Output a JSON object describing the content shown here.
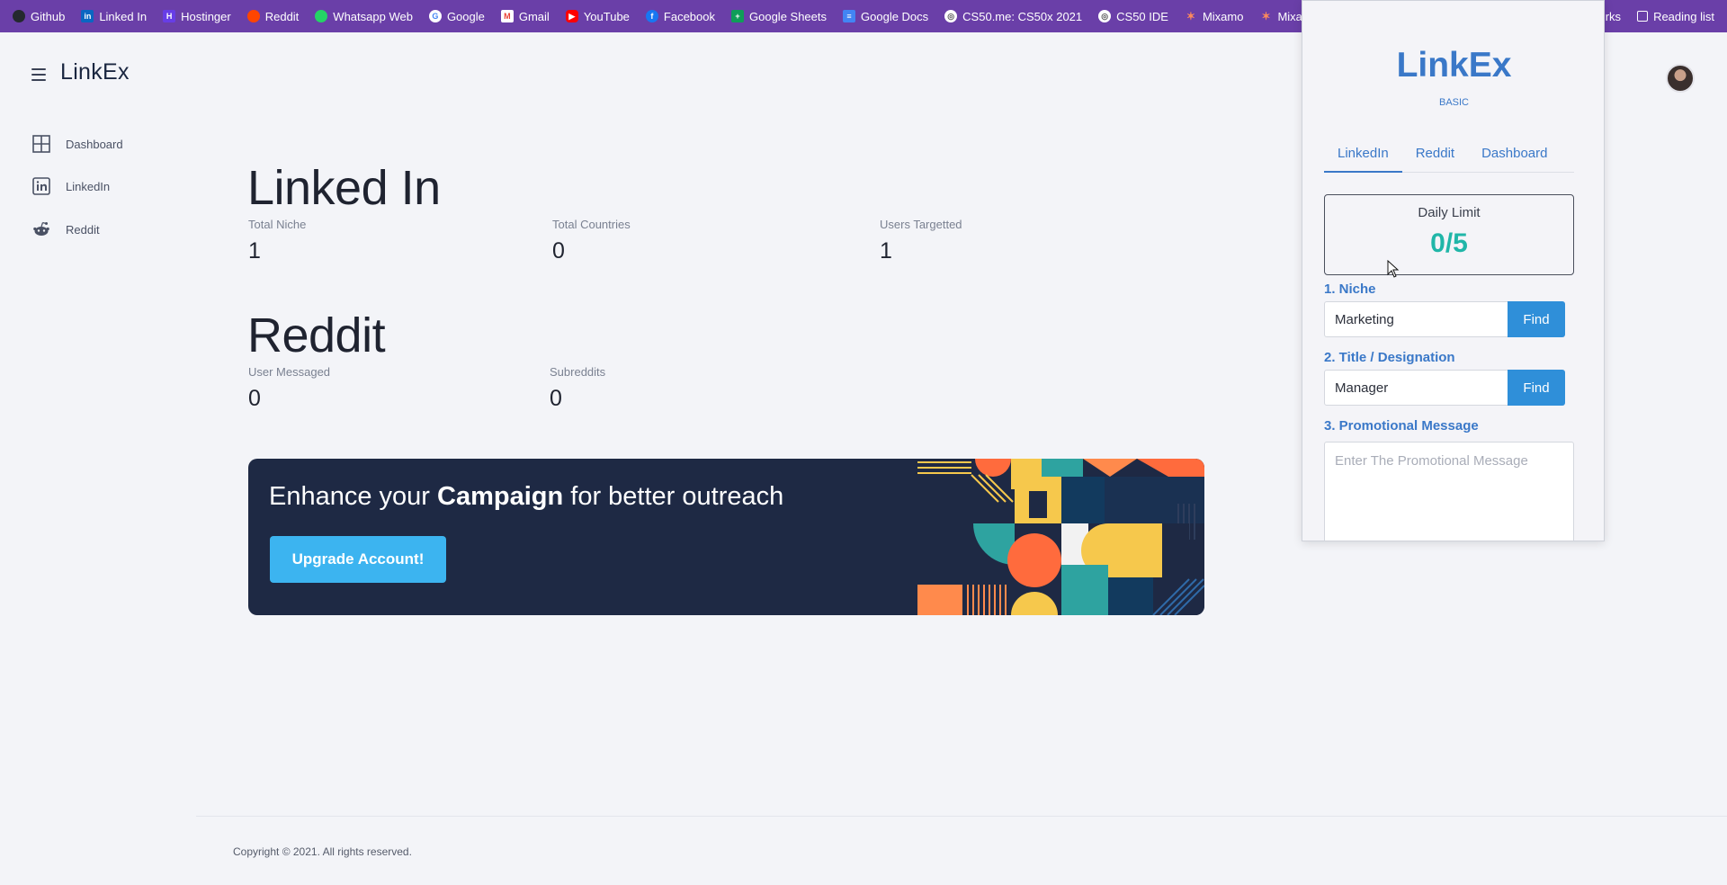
{
  "bookmarks": {
    "items": [
      {
        "label": "Github",
        "icon": "github-icon",
        "color": "#24292e"
      },
      {
        "label": "Linked In",
        "icon": "linkedin-icon",
        "color": "#0a66c2"
      },
      {
        "label": "Hostinger",
        "icon": "hostinger-icon",
        "color": "#673de6"
      },
      {
        "label": "Reddit",
        "icon": "reddit-icon",
        "color": "#ff4500"
      },
      {
        "label": "Whatsapp Web",
        "icon": "whatsapp-icon",
        "color": "#25d366"
      },
      {
        "label": "Google",
        "icon": "google-icon",
        "color": "#4285f4"
      },
      {
        "label": "Gmail",
        "icon": "gmail-icon",
        "color": "#ea4335"
      },
      {
        "label": "YouTube",
        "icon": "youtube-icon",
        "color": "#ff0000"
      },
      {
        "label": "Facebook",
        "icon": "facebook-icon",
        "color": "#1877f2"
      },
      {
        "label": "Google Sheets",
        "icon": "sheets-icon",
        "color": "#0f9d58"
      },
      {
        "label": "Google Docs",
        "icon": "docs-icon",
        "color": "#4285f4"
      },
      {
        "label": "CS50.me: CS50x 2021",
        "icon": "globe-icon",
        "color": "#5b5b5b"
      },
      {
        "label": "CS50 IDE",
        "icon": "globe-icon",
        "color": "#5b5b5b"
      },
      {
        "label": "Mixamo",
        "icon": "mixamo-icon",
        "color": "#ff6a3d"
      },
      {
        "label": "Mixamo",
        "icon": "mixamo-icon",
        "color": "#ff6a3d"
      }
    ],
    "other_partial": "rks",
    "reading_list": "Reading list"
  },
  "header": {
    "brand": "LinkEx"
  },
  "sidebar": {
    "items": [
      {
        "label": "Dashboard",
        "icon": "grid-icon"
      },
      {
        "label": "LinkedIn",
        "icon": "linkedin-icon"
      },
      {
        "label": "Reddit",
        "icon": "reddit-icon"
      }
    ]
  },
  "linkedin": {
    "title": "Linked In",
    "stats": [
      {
        "label": "Total Niche",
        "value": "1"
      },
      {
        "label": "Total Countries",
        "value": "0"
      },
      {
        "label": "Users Targetted",
        "value": "1"
      }
    ]
  },
  "reddit": {
    "title": "Reddit",
    "stats": [
      {
        "label": "User Messaged",
        "value": "0"
      },
      {
        "label": "Subreddits",
        "value": "0"
      }
    ]
  },
  "banner": {
    "text_pre": "Enhance your ",
    "text_bold": "Campaign",
    "text_post": " for better outreach",
    "button": "Upgrade Account!",
    "colors": {
      "background": "#1e2944",
      "button": "#3cb4f0"
    }
  },
  "footer": {
    "copyright": "Copyright © 2021. All rights reserved."
  },
  "popup": {
    "title": "LinkEx",
    "plan": "BASIC",
    "tabs": [
      "LinkedIn",
      "Reddit",
      "Dashboard"
    ],
    "active_tab": "LinkedIn",
    "daily_limit_label": "Daily Limit",
    "daily_limit_value": "0/5",
    "niche_label": "1. Niche",
    "niche_value": "Marketing",
    "title_label": "2. Title / Designation",
    "title_value": "Manager",
    "find_label": "Find",
    "message_label": "3. Promotional Message",
    "message_placeholder": "Enter The Promotional Message",
    "colors": {
      "accent": "#3a78c8",
      "limit": "#20b6a8",
      "find": "#2f8fd9"
    }
  }
}
